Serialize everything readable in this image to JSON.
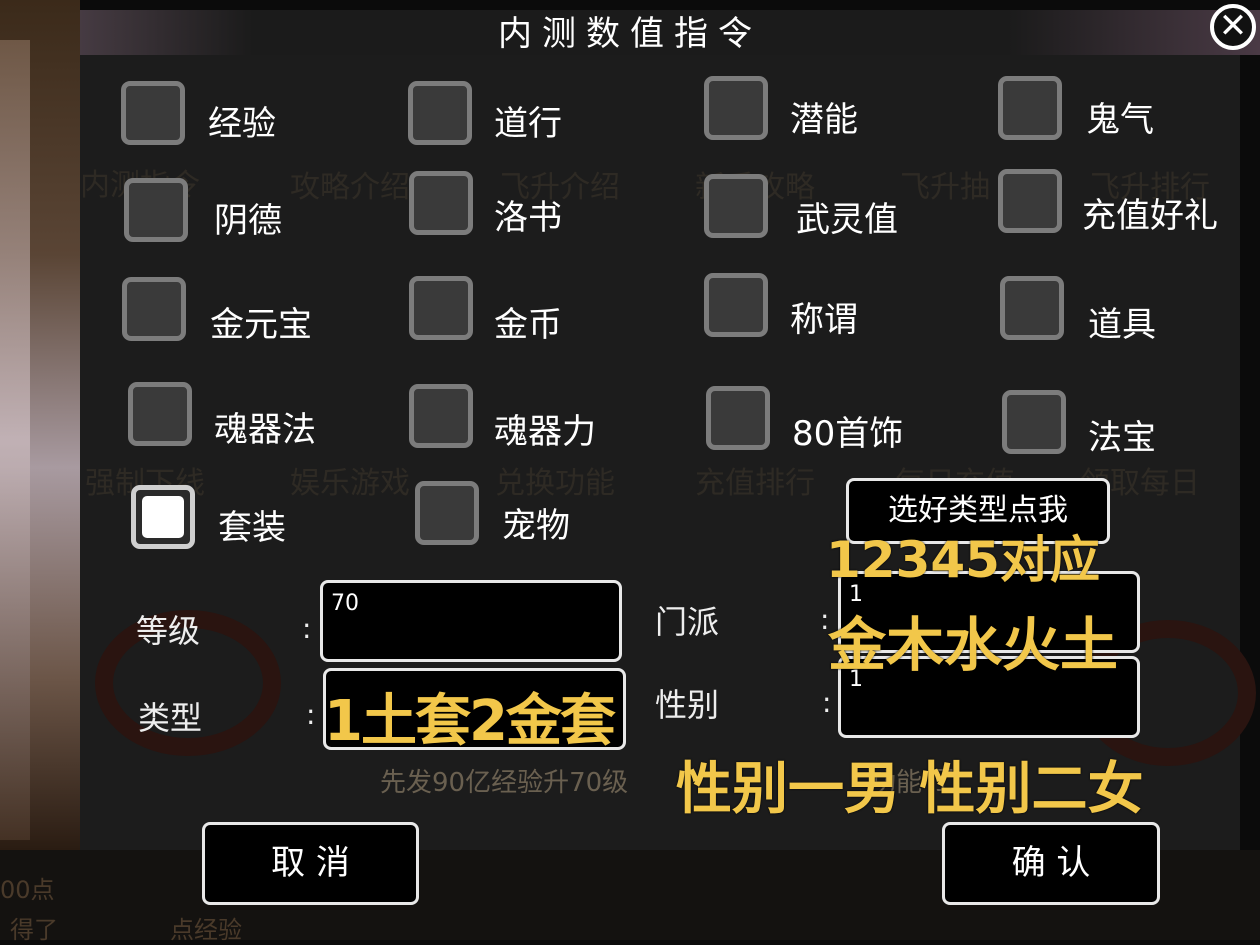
{
  "dialog": {
    "title": "内测数值指令",
    "options": [
      {
        "label": "经验",
        "checked": false
      },
      {
        "label": "道行",
        "checked": false
      },
      {
        "label": "潜能",
        "checked": false
      },
      {
        "label": "鬼气",
        "checked": false
      },
      {
        "label": "阴德",
        "checked": false
      },
      {
        "label": "洛书",
        "checked": false
      },
      {
        "label": "武灵值",
        "checked": false
      },
      {
        "label": "充值好礼",
        "checked": false
      },
      {
        "label": "金元宝",
        "checked": false
      },
      {
        "label": "金币",
        "checked": false
      },
      {
        "label": "称谓",
        "checked": false
      },
      {
        "label": "道具",
        "checked": false
      },
      {
        "label": "魂器法",
        "checked": false
      },
      {
        "label": "魂器力",
        "checked": false
      },
      {
        "label": "80首饰",
        "checked": false
      },
      {
        "label": "法宝",
        "checked": false
      },
      {
        "label": "套装",
        "checked": true
      },
      {
        "label": "宠物",
        "checked": false
      }
    ],
    "select_type_button": "选好类型点我",
    "fields": {
      "level": {
        "label": "等级",
        "colon": ":",
        "value": "70"
      },
      "type": {
        "label": "类型",
        "colon": ":",
        "value": ""
      },
      "school": {
        "label": "门派",
        "colon": ":",
        "value": "1"
      },
      "gender": {
        "label": "性别",
        "colon": ":",
        "value": "1"
      }
    },
    "cancel_button": "取 消",
    "confirm_button": "确 认"
  },
  "annotations": {
    "school_map_line1": "12345对应",
    "school_map_line2": "金木水火土",
    "type_hint": "1土套2金套",
    "gender_hint": "性别一男 性别二女"
  },
  "background": {
    "hint_text": "先发90亿经验升70级",
    "hint_tail": "功能",
    "hint_end": "了",
    "bottom_line1": "00点",
    "bottom_line2": "得了",
    "bottom_tail": "点经验",
    "faded_buttons": [
      "内测指令",
      "攻略介绍",
      "飞升介绍",
      "新手攻略",
      "飞升抽",
      "飞升排行",
      "强制下线",
      "娱乐游戏",
      "兑换功能",
      "充值排行",
      "每日充值",
      "领取每日"
    ]
  },
  "colors": {
    "accent_gold": "#f2c74a",
    "panel": "#1c1c1c"
  }
}
